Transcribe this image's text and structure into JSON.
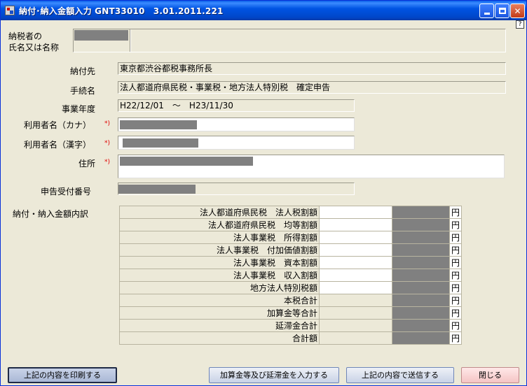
{
  "window": {
    "title": "納付･納入金額入力 GNT33010　3.01.2011.221",
    "help_label": "?"
  },
  "form": {
    "taxpayer_label_line1": "納税者の",
    "taxpayer_label_line2": "氏名又は名称",
    "payee_label": "納付先",
    "payee_value": "東京都渋谷都税事務所長",
    "procedure_label": "手続名",
    "procedure_value": "法人都道府県民税・事業税・地方法人特別税　確定申告",
    "fiscal_year_label": "事業年度",
    "fiscal_year_value": "H22/12/01　～　H23/11/30",
    "user_kana_label": "利用者名（カナ）",
    "user_kanji_label": "利用者名（漢字）",
    "address_label": "住所",
    "receipt_no_label": "申告受付番号",
    "required_mark": "*)",
    "breakdown_label": "納付・納入金額内訳"
  },
  "breakdown": {
    "unit": "円",
    "rows": [
      {
        "label": "法人都道府県民税　法人税割額"
      },
      {
        "label": "法人都道府県民税　均等割額"
      },
      {
        "label": "法人事業税　所得割額"
      },
      {
        "label": "法人事業税　付加価値割額"
      },
      {
        "label": "法人事業税　資本割額"
      },
      {
        "label": "法人事業税　収入割額"
      },
      {
        "label": "地方法人特別税額"
      },
      {
        "label": "本税合計"
      },
      {
        "label": "加算金等合計"
      },
      {
        "label": "延滞金合計"
      },
      {
        "label": "合計額"
      }
    ]
  },
  "buttons": {
    "print": "上記の内容を印刷する",
    "add_penalty": "加算金等及び延滞金を入力する",
    "send": "上記の内容で送信する",
    "close": "閉じる"
  }
}
